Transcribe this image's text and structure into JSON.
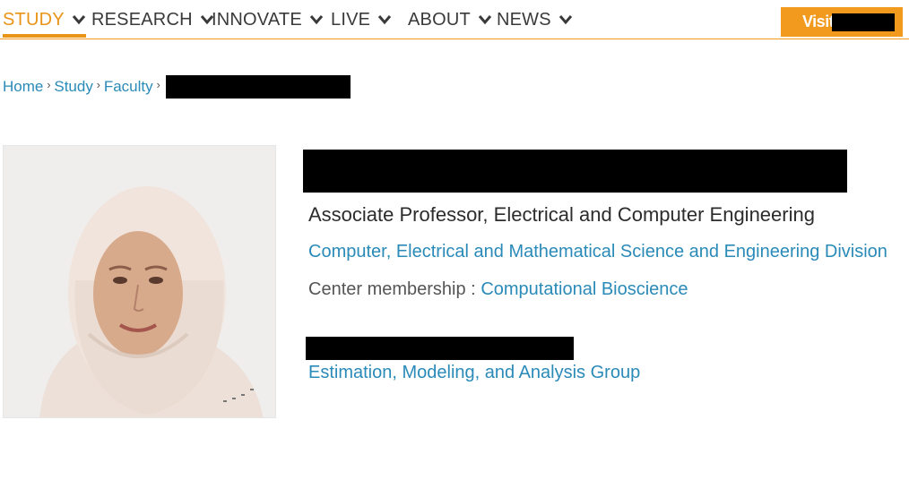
{
  "nav": {
    "items": [
      {
        "label": "STUDY",
        "active": true
      },
      {
        "label": "RESEARCH",
        "active": false
      },
      {
        "label": "INNOVATE",
        "active": false
      },
      {
        "label": "LIVE",
        "active": false
      },
      {
        "label": "ABOUT",
        "active": false
      },
      {
        "label": "NEWS",
        "active": false
      }
    ],
    "visit_label": "Visit",
    "accent_color": "#e99416",
    "icon": "chevron-down-icon"
  },
  "breadcrumb": {
    "items": [
      "Home",
      "Study",
      "Faculty"
    ],
    "separator_icon": "chevron-right-icon"
  },
  "profile": {
    "photo_icon": "faculty-portrait",
    "position": "Associate Professor, Electrical and Computer Engineering",
    "division": "Computer, Electrical and Mathematical Science and Engineering Division",
    "center_label": "Center membership :",
    "center": "Computational Bioscience",
    "group": "Estimation, Modeling, and Analysis Group",
    "link_color": "#2a8ab8"
  }
}
